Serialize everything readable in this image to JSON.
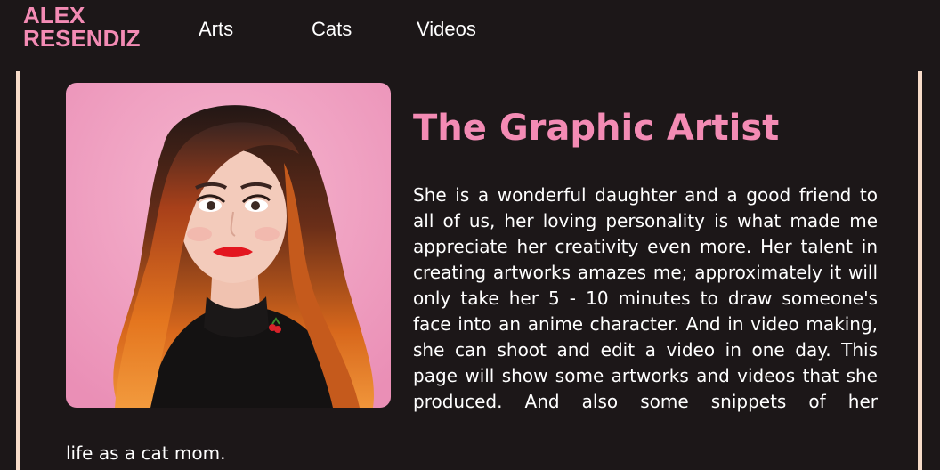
{
  "header": {
    "logo_line1": "ALEX",
    "logo_line2": "RESENDIZ",
    "nav": [
      {
        "label": "Arts"
      },
      {
        "label": "Cats"
      },
      {
        "label": "Videos"
      }
    ]
  },
  "main": {
    "heading": "The Graphic Artist",
    "paragraph": "She is a wonderful daughter and a good friend to all of us, her loving personality is what made me appreciate her creativity even more. Her talent in creating artworks amazes me; approximately it will only take her 5 - 10 minutes to draw someone's face into an anime character. And in video making, she can shoot and edit a video in one day. This page will show some artworks and videos that she produced. And also some snippets of her",
    "paragraph_tail": "life as a cat mom."
  },
  "colors": {
    "accent": "#f38bb4",
    "background": "#1c1718",
    "border": "#f7dcc9",
    "text": "#ffffff"
  }
}
